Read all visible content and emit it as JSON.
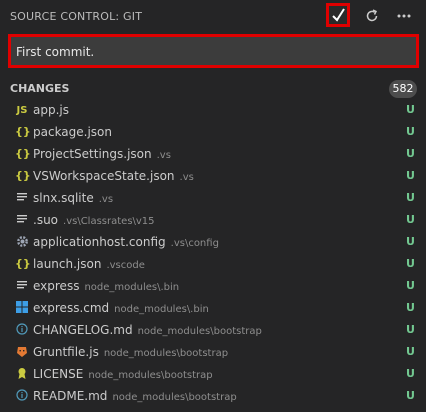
{
  "header": {
    "title": "SOURCE CONTROL: GIT"
  },
  "commit": {
    "message": "First commit."
  },
  "changes": {
    "title": "CHANGES",
    "count": "582"
  },
  "files": [
    {
      "name": "app.js",
      "path": "",
      "icon": "js-icon",
      "status": "U"
    },
    {
      "name": "package.json",
      "path": "",
      "icon": "json-icon",
      "status": "U"
    },
    {
      "name": "ProjectSettings.json",
      "path": ".vs",
      "icon": "json-icon",
      "status": "U"
    },
    {
      "name": "VSWorkspaceState.json",
      "path": ".vs",
      "icon": "json-icon",
      "status": "U"
    },
    {
      "name": "slnx.sqlite",
      "path": ".vs",
      "icon": "text-lines-icon",
      "status": "U"
    },
    {
      "name": ".suo",
      "path": ".vs\\Classrates\\v15",
      "icon": "text-lines-icon",
      "status": "U"
    },
    {
      "name": "applicationhost.config",
      "path": ".vs\\config",
      "icon": "gear-icon",
      "status": "U"
    },
    {
      "name": "launch.json",
      "path": ".vscode",
      "icon": "json-icon",
      "status": "U"
    },
    {
      "name": "express",
      "path": "node_modules\\.bin",
      "icon": "text-lines-icon",
      "status": "U"
    },
    {
      "name": "express.cmd",
      "path": "node_modules\\.bin",
      "icon": "windows-icon",
      "status": "U"
    },
    {
      "name": "CHANGELOG.md",
      "path": "node_modules\\bootstrap",
      "icon": "info-icon",
      "status": "U"
    },
    {
      "name": "Gruntfile.js",
      "path": "node_modules\\bootstrap",
      "icon": "grunt-icon",
      "status": "U"
    },
    {
      "name": "LICENSE",
      "path": "node_modules\\bootstrap",
      "icon": "license-icon",
      "status": "U"
    },
    {
      "name": "README.md",
      "path": "node_modules\\bootstrap",
      "icon": "info-icon",
      "status": "U"
    }
  ]
}
